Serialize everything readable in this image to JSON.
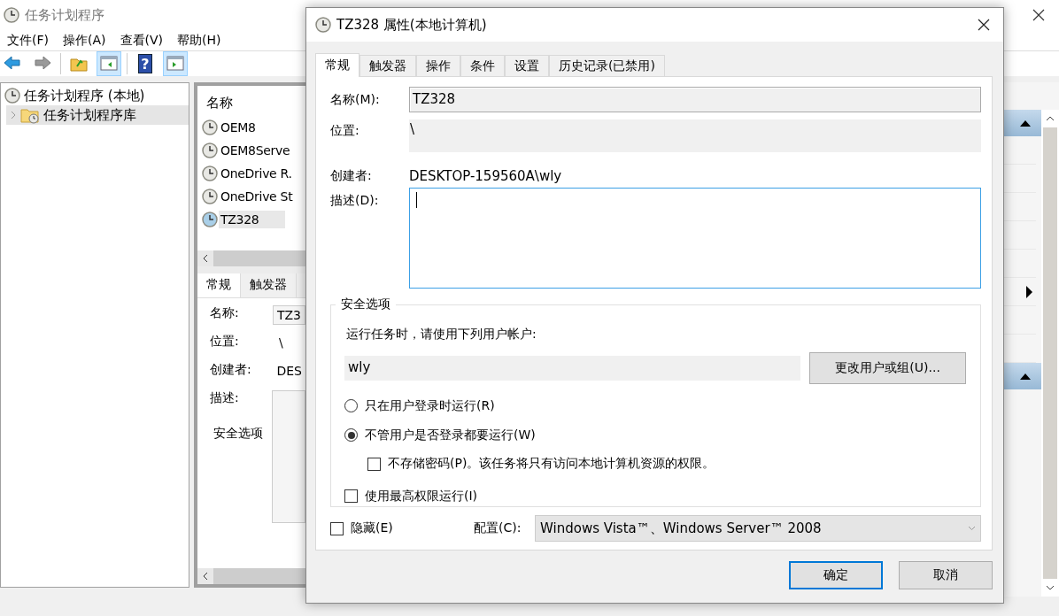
{
  "window": {
    "title": "任务计划程序"
  },
  "menu": [
    {
      "label": "文件(F)"
    },
    {
      "label": "操作(A)"
    },
    {
      "label": "查看(V)"
    },
    {
      "label": "帮助(H)"
    }
  ],
  "toolbar": [
    {
      "kind": "back",
      "pressed": false
    },
    {
      "kind": "forward",
      "pressed": false
    },
    {
      "kind": "separator"
    },
    {
      "kind": "up",
      "pressed": false
    },
    {
      "kind": "tree-pane",
      "pressed": true
    },
    {
      "kind": "separator"
    },
    {
      "kind": "help",
      "glyph": "?",
      "pressed": false
    },
    {
      "kind": "action-pane",
      "pressed": true
    }
  ],
  "tree": [
    {
      "label": "任务计划程序 (本地)",
      "selected": false,
      "children": [
        {
          "label": "任务计划程序库",
          "selected": true
        }
      ]
    }
  ],
  "task_list": {
    "column": "名称",
    "rows": [
      {
        "name": "OEM8",
        "selected": false
      },
      {
        "name": "OEM8Serve",
        "selected": false
      },
      {
        "name": "OneDrive R.",
        "selected": false
      },
      {
        "name": "OneDrive St",
        "selected": false
      },
      {
        "name": "TZ328",
        "selected": true
      }
    ]
  },
  "details": {
    "tabs": [
      {
        "label": "常规",
        "selected": true
      },
      {
        "label": "触发器",
        "selected": false
      }
    ],
    "fields": [
      {
        "label": "名称:",
        "value": "TZ3"
      },
      {
        "label": "位置:",
        "value": "\\"
      },
      {
        "label": "创建者:",
        "value": "DES"
      },
      {
        "label": "描述:"
      }
    ],
    "group_title": "安全选项"
  },
  "actions_pane": {
    "sections": [
      {
        "expanded": true
      },
      {
        "expanded": true
      }
    ]
  },
  "dialog": {
    "title": "TZ328 属性(本地计算机)",
    "tabs": [
      {
        "label": "常规",
        "selected": true
      },
      {
        "label": "触发器",
        "selected": false
      },
      {
        "label": "操作",
        "selected": false
      },
      {
        "label": "条件",
        "selected": false
      },
      {
        "label": "设置",
        "selected": false
      },
      {
        "label": "历史记录(已禁用)",
        "selected": false
      }
    ],
    "name": {
      "label": "名称(M):",
      "value": "TZ328"
    },
    "location": {
      "label": "位置:",
      "value": "\\"
    },
    "author": {
      "label": "创建者:",
      "value": "DESKTOP-159560A\\wly"
    },
    "description": {
      "label": "描述(D):",
      "focused": true
    },
    "security": {
      "title": "安全选项",
      "run_as_label": "运行任务时，请使用下列用户帐户:",
      "user": "wly",
      "change_button": "更改用户或组(U)...",
      "options": [
        {
          "kind": "radio",
          "label": "只在用户登录时运行(R)",
          "selected": false
        },
        {
          "kind": "radio",
          "label": "不管用户是否登录都要运行(W)",
          "selected": true
        },
        {
          "kind": "checkbox",
          "label": "不存储密码(P)。该任务将只有访问本地计算机资源的权限。",
          "checked": false,
          "indented": true
        },
        {
          "kind": "checkbox",
          "label": "使用最高权限运行(I)",
          "checked": false,
          "indented": false
        }
      ]
    },
    "hidden": {
      "label": "隐藏(E)",
      "checked": false
    },
    "config": {
      "label": "配置(C):",
      "value": "Windows Vista™、Windows Server™ 2008"
    },
    "buttons": [
      {
        "label": "确定",
        "default": true
      },
      {
        "label": "取消",
        "default": false
      }
    ]
  }
}
